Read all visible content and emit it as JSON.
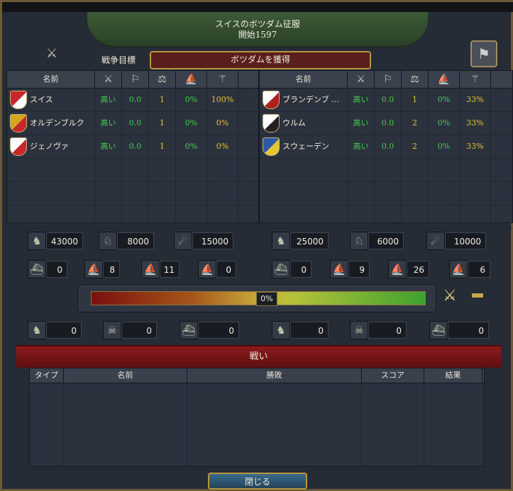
{
  "title": {
    "line1": "スイスのボツダム征服",
    "line2": "開始1597"
  },
  "war_goal": {
    "label": "戦争目標",
    "value": "ボツダムを獲得"
  },
  "icons": {
    "crossed_swords": "crossed-swords-icon",
    "map_button": "map-icon"
  },
  "table_headers": {
    "name": "名前"
  },
  "attackers": [
    {
      "name": "スイス",
      "c1": "高い",
      "c2": "0.0",
      "c3": "1",
      "c4": "0%",
      "c5": "100%",
      "flag_colors": [
        "#c7282a",
        "#ffffff"
      ]
    },
    {
      "name": "オルデンブルク",
      "c1": "高い",
      "c2": "0.0",
      "c3": "1",
      "c4": "0%",
      "c5": "0%",
      "flag_colors": [
        "#d4a520",
        "#c7282a"
      ]
    },
    {
      "name": "ジェノヴァ",
      "c1": "高い",
      "c2": "0.0",
      "c3": "1",
      "c4": "0%",
      "c5": "0%",
      "flag_colors": [
        "#ffffff",
        "#c7282a"
      ]
    }
  ],
  "defenders": [
    {
      "name": "ブランデンブ ...",
      "c1": "高い",
      "c2": "0.0",
      "c3": "1",
      "c4": "0%",
      "c5": "33%",
      "flag_colors": [
        "#ffffff",
        "#b02020"
      ]
    },
    {
      "name": "ウルム",
      "c1": "高い",
      "c2": "0.0",
      "c3": "2",
      "c4": "0%",
      "c5": "33%",
      "flag_colors": [
        "#ffffff",
        "#222222"
      ]
    },
    {
      "name": "スウェーデン",
      "c1": "高い",
      "c2": "0.0",
      "c3": "2",
      "c4": "0%",
      "c5": "33%",
      "flag_colors": [
        "#2c5aa8",
        "#e6c532"
      ]
    }
  ],
  "attacker_forces": {
    "infantry": "43000",
    "cavalry": "8000",
    "artillery": "15000",
    "heavy_ships": "0",
    "light_ships": "8",
    "galleys": "11",
    "transports": "0",
    "losses_land": "0",
    "losses_attrition": "0",
    "losses_naval": "0"
  },
  "defender_forces": {
    "infantry": "25000",
    "cavalry": "6000",
    "artillery": "10000",
    "heavy_ships": "0",
    "light_ships": "9",
    "galleys": "26",
    "transports": "6",
    "losses_land": "0",
    "losses_attrition": "0",
    "losses_naval": "0"
  },
  "war_score": {
    "label": "0%",
    "value": 0
  },
  "battles": {
    "banner": "戦い",
    "headers": [
      "タイプ",
      "名前",
      "勝敗",
      "スコア",
      "結果"
    ]
  },
  "close_label": "閉じる"
}
